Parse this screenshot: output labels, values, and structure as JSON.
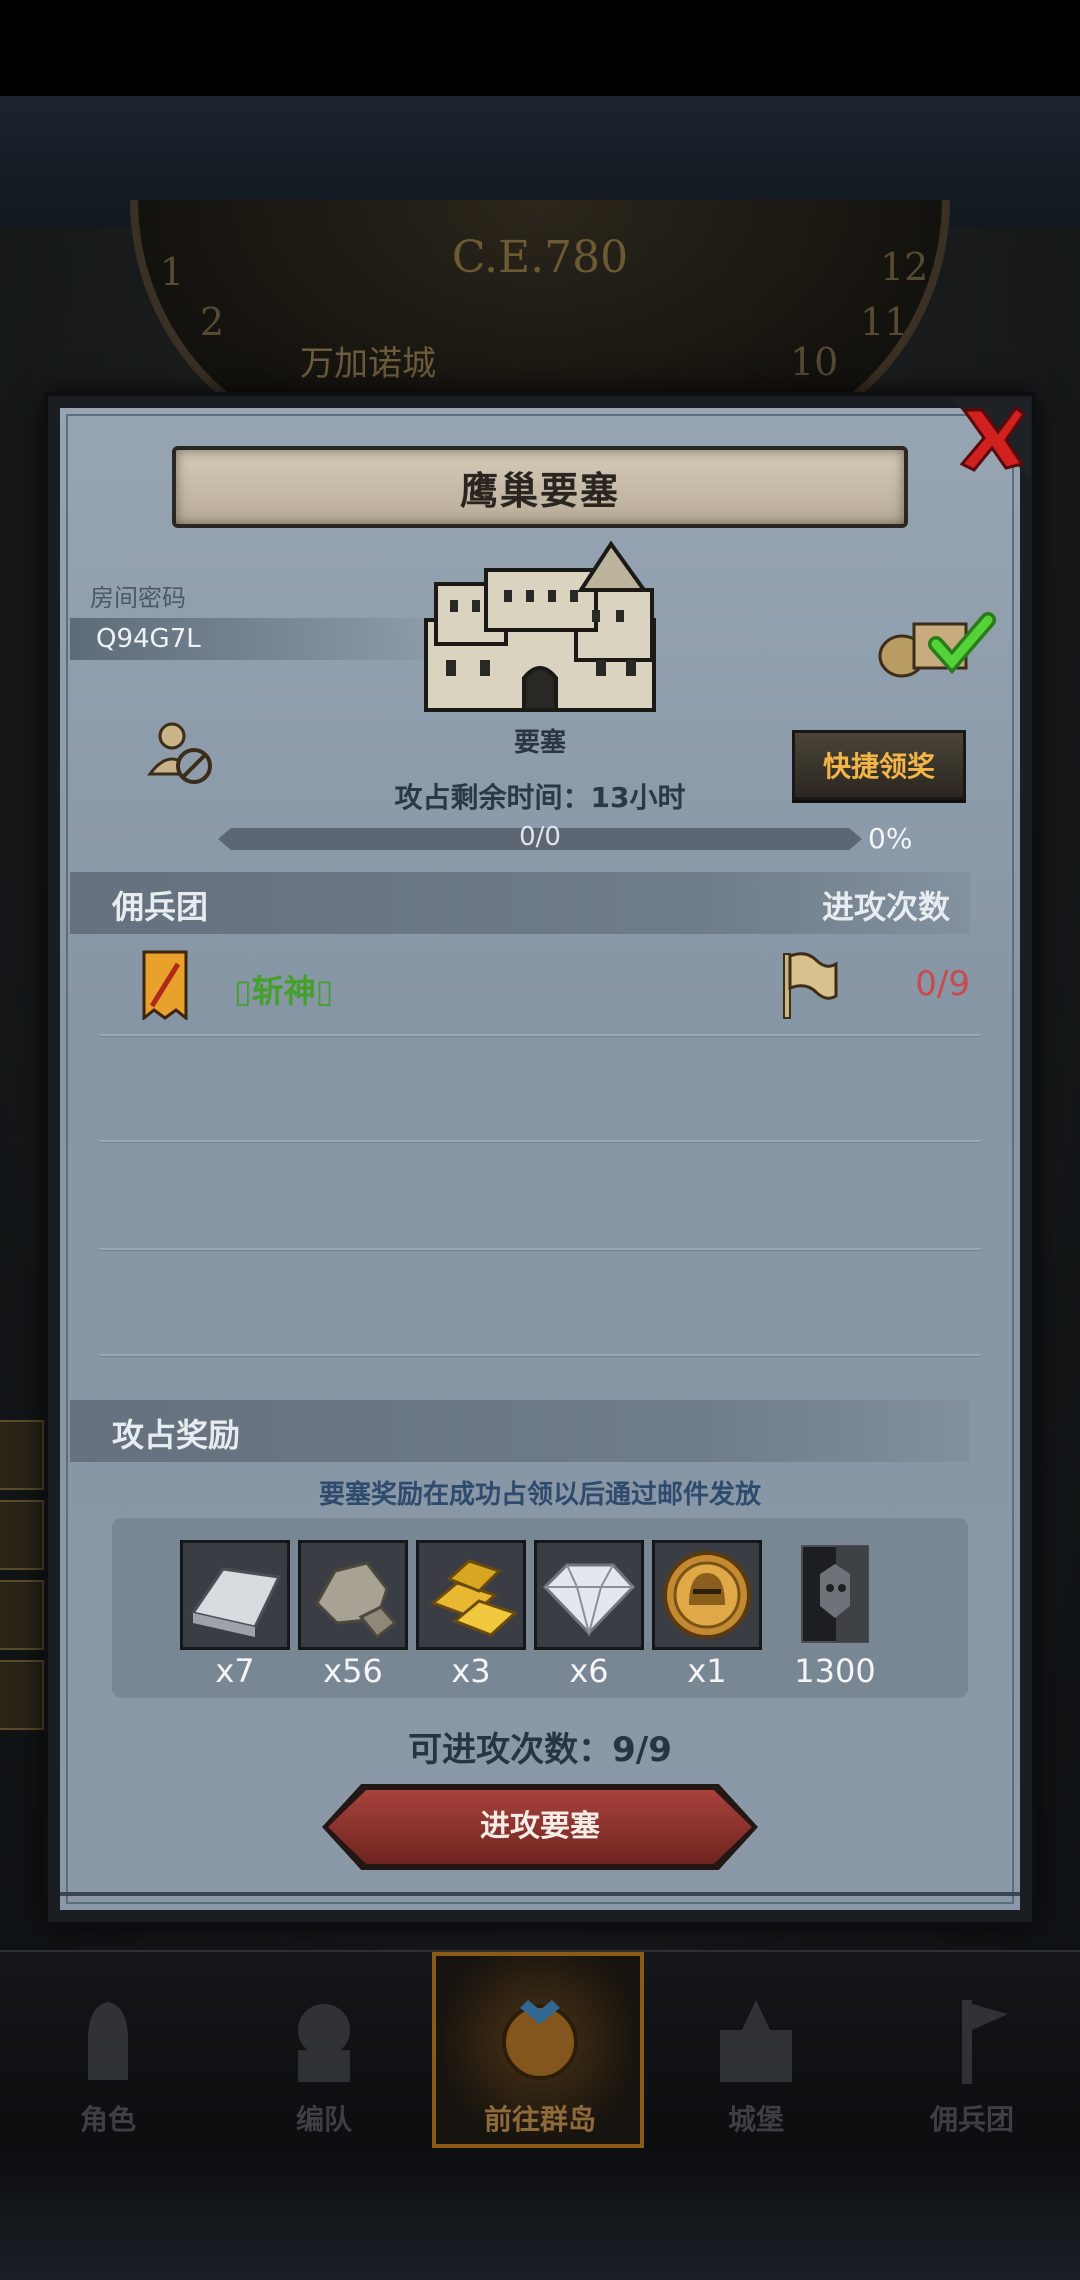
{
  "background": {
    "era": "C.E.780",
    "dial_numbers": [
      "12",
      "1",
      "2",
      "10",
      "11"
    ],
    "side_text": "万加诺城"
  },
  "dialog": {
    "title": "鹰巢要塞",
    "room": {
      "label": "房间密码",
      "code": "Q94G7L"
    },
    "fortress": {
      "label": "要塞",
      "icon": "castle-icon"
    },
    "quick_claim_label": "快捷领奖",
    "time_remaining": "攻占剩余时间：13小时",
    "progress": {
      "text": "0/0",
      "percent_label": "0%",
      "fraction": 0
    },
    "mercenary_header": "佣兵团",
    "attack_count_header": "进攻次数",
    "rows": [
      {
        "name": "▯斩神▯",
        "count": "0/9"
      }
    ],
    "rewards_header": "攻占奖励",
    "rewards_note": "要塞奖励在成功占领以后通过邮件发放",
    "rewards": [
      {
        "icon": "silver-ingot-icon",
        "qty": "x7"
      },
      {
        "icon": "stone-ore-icon",
        "qty": "x56"
      },
      {
        "icon": "gold-bar-icon",
        "qty": "x3"
      },
      {
        "icon": "diamond-icon",
        "qty": "x6"
      },
      {
        "icon": "knight-medal-icon",
        "qty": "x1"
      },
      {
        "icon": "honor-banner-icon",
        "qty": "1300"
      }
    ],
    "attacks_available": "可进攻次数：9/9",
    "attack_button": "进攻要塞"
  },
  "nav": {
    "items": [
      {
        "label": "角色",
        "icon": "knight-icon"
      },
      {
        "label": "编队",
        "icon": "team-icon"
      },
      {
        "label": "前往群岛",
        "icon": "island-icon"
      },
      {
        "label": "城堡",
        "icon": "castle-icon"
      },
      {
        "label": "佣兵团",
        "icon": "mercenary-icon"
      }
    ]
  },
  "colors": {
    "dialog_bg": "#8e9cab",
    "accent_gold": "#f3b548",
    "guild_name": "#43a12a",
    "count_red": "#c94a4a",
    "attack_button": "#8f3530",
    "close_red": "#d12020"
  }
}
